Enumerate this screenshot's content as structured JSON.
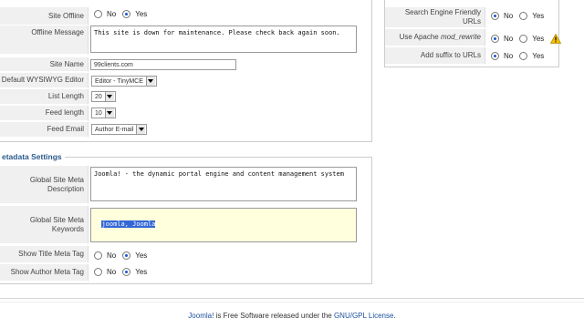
{
  "site_settings": {
    "site_offline": {
      "label": "Site Offline",
      "options": [
        "No",
        "Yes"
      ],
      "selected": "Yes"
    },
    "offline_message": {
      "label": "Offline Message",
      "value": "This site is down for maintenance. Please check back again soon."
    },
    "site_name": {
      "label": "Site Name",
      "value": "99clients.com"
    },
    "default_editor": {
      "label": "Default WYSIWYG Editor",
      "value": "Editor - TinyMCE"
    },
    "list_length": {
      "label": "List Length",
      "value": "20"
    },
    "feed_length": {
      "label": "Feed length",
      "value": "10"
    },
    "feed_email": {
      "label": "Feed Email",
      "value": "Author E-mail"
    }
  },
  "seo_settings": {
    "sef_urls": {
      "label": "Search Engine Friendly URLs",
      "options": [
        "No",
        "Yes"
      ],
      "selected": "No"
    },
    "mod_rewrite": {
      "label_prefix": "Use Apache ",
      "label_em": "mod_rewrite",
      "options": [
        "No",
        "Yes"
      ],
      "selected": "No"
    },
    "url_suffix": {
      "label": "Add suffix to URLs",
      "options": [
        "No",
        "Yes"
      ],
      "selected": "No"
    }
  },
  "metadata_settings": {
    "legend": "etadata Settings",
    "description": {
      "label": "Global Site Meta Description",
      "value": "Joomla! - the dynamic portal engine and content management system"
    },
    "keywords": {
      "label": "Global Site Meta Keywords",
      "value": "joomla, Joomla"
    },
    "show_title": {
      "label": "Show Title Meta Tag",
      "options": [
        "No",
        "Yes"
      ],
      "selected": "Yes"
    },
    "show_author": {
      "label": "Show Author Meta Tag",
      "options": [
        "No",
        "Yes"
      ],
      "selected": "Yes"
    }
  },
  "footer": {
    "link1": "Joomla!",
    "text": " is Free Software released under the ",
    "link2": "GNU/GPL License",
    "end": "."
  },
  "colors": {
    "legend": "#2b5a8c",
    "label_bg": "#f0f0f0",
    "selection": "#3367d6",
    "keywords_bg": "#ffffdd"
  }
}
